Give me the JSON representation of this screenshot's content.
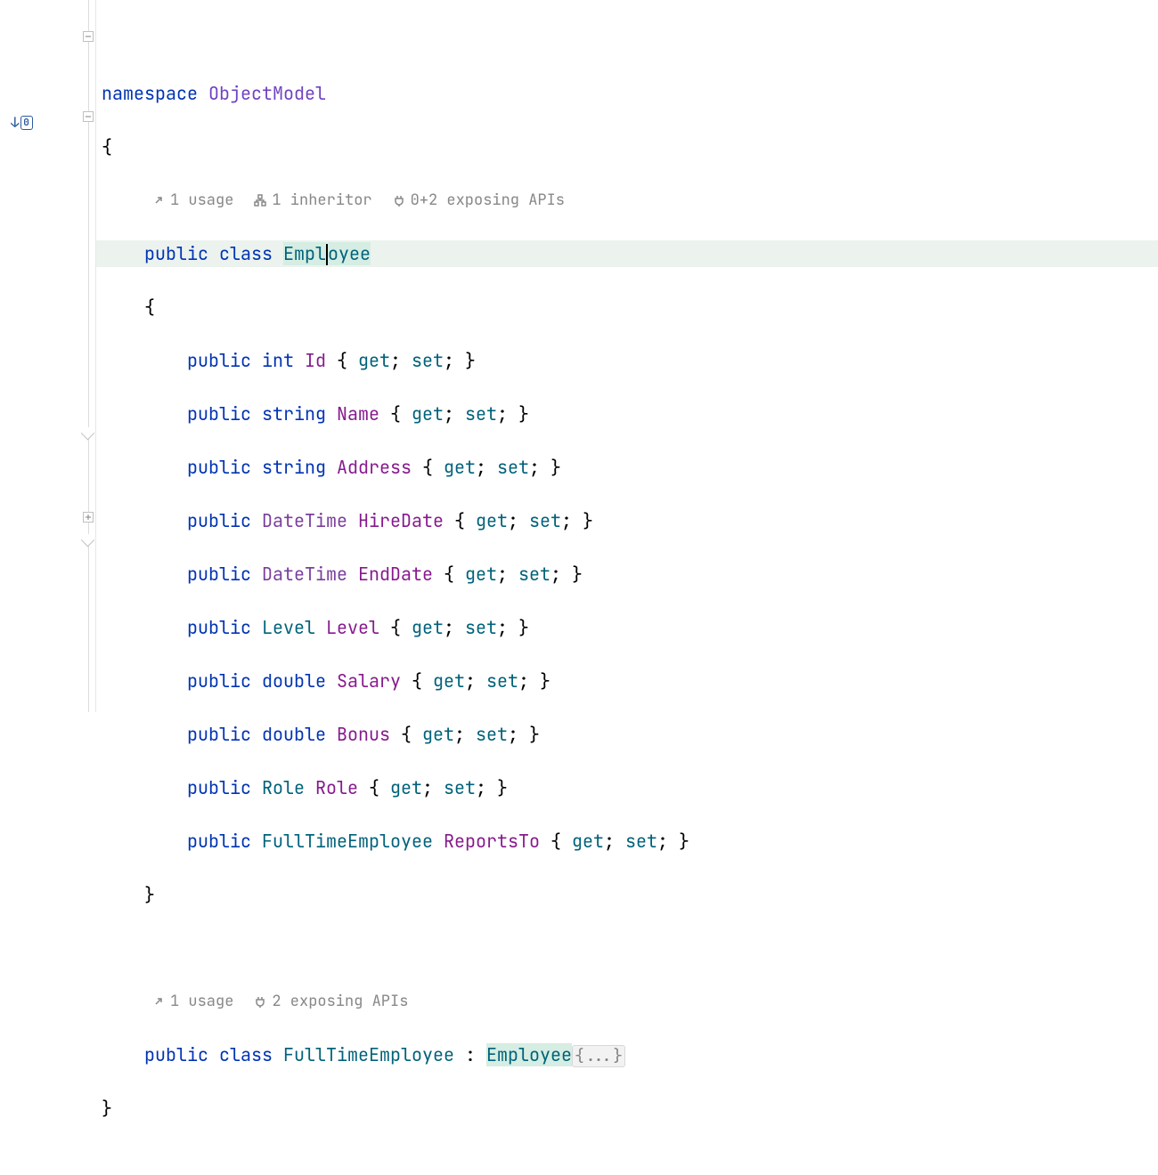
{
  "bookmark": {
    "label": "0"
  },
  "code_lens_1": {
    "usage": "1 usage",
    "inheritor": "1 inheritor",
    "exposing": "0+2 exposing APIs"
  },
  "code_lens_2": {
    "usage": "1 usage",
    "exposing": "2 exposing APIs"
  },
  "ns": {
    "keyword": "namespace",
    "name": "ObjectModel"
  },
  "brace_open": "{",
  "brace_close": "}",
  "class1": {
    "modifier": "public",
    "keyword": "class",
    "name_a": "Empl",
    "name_b": "oyee"
  },
  "prop_template": {
    "modifier": "public",
    "get": "get",
    "set": "set",
    "semi": ";",
    "lbrace": "{",
    "rbrace": "}"
  },
  "props": [
    {
      "type": "int",
      "name": "Id",
      "tclass": "builtin"
    },
    {
      "type": "string",
      "name": "Name",
      "tclass": "builtin"
    },
    {
      "type": "string",
      "name": "Address",
      "tclass": "builtin"
    },
    {
      "type": "DateTime",
      "name": "HireDate",
      "tclass": "type"
    },
    {
      "type": "DateTime",
      "name": "EndDate",
      "tclass": "type"
    },
    {
      "type": "Level",
      "name": "Level",
      "tclass": "ident"
    },
    {
      "type": "double",
      "name": "Salary",
      "tclass": "builtin"
    },
    {
      "type": "double",
      "name": "Bonus",
      "tclass": "builtin"
    },
    {
      "type": "Role",
      "name": "Role",
      "tclass": "ident"
    },
    {
      "type": "FullTimeEmployee",
      "name": "ReportsTo",
      "tclass": "ident"
    }
  ],
  "class2": {
    "modifier": "public",
    "keyword": "class",
    "name": "FullTimeEmployee",
    "colon": ":",
    "base": "Employee",
    "folded": "{...}"
  }
}
